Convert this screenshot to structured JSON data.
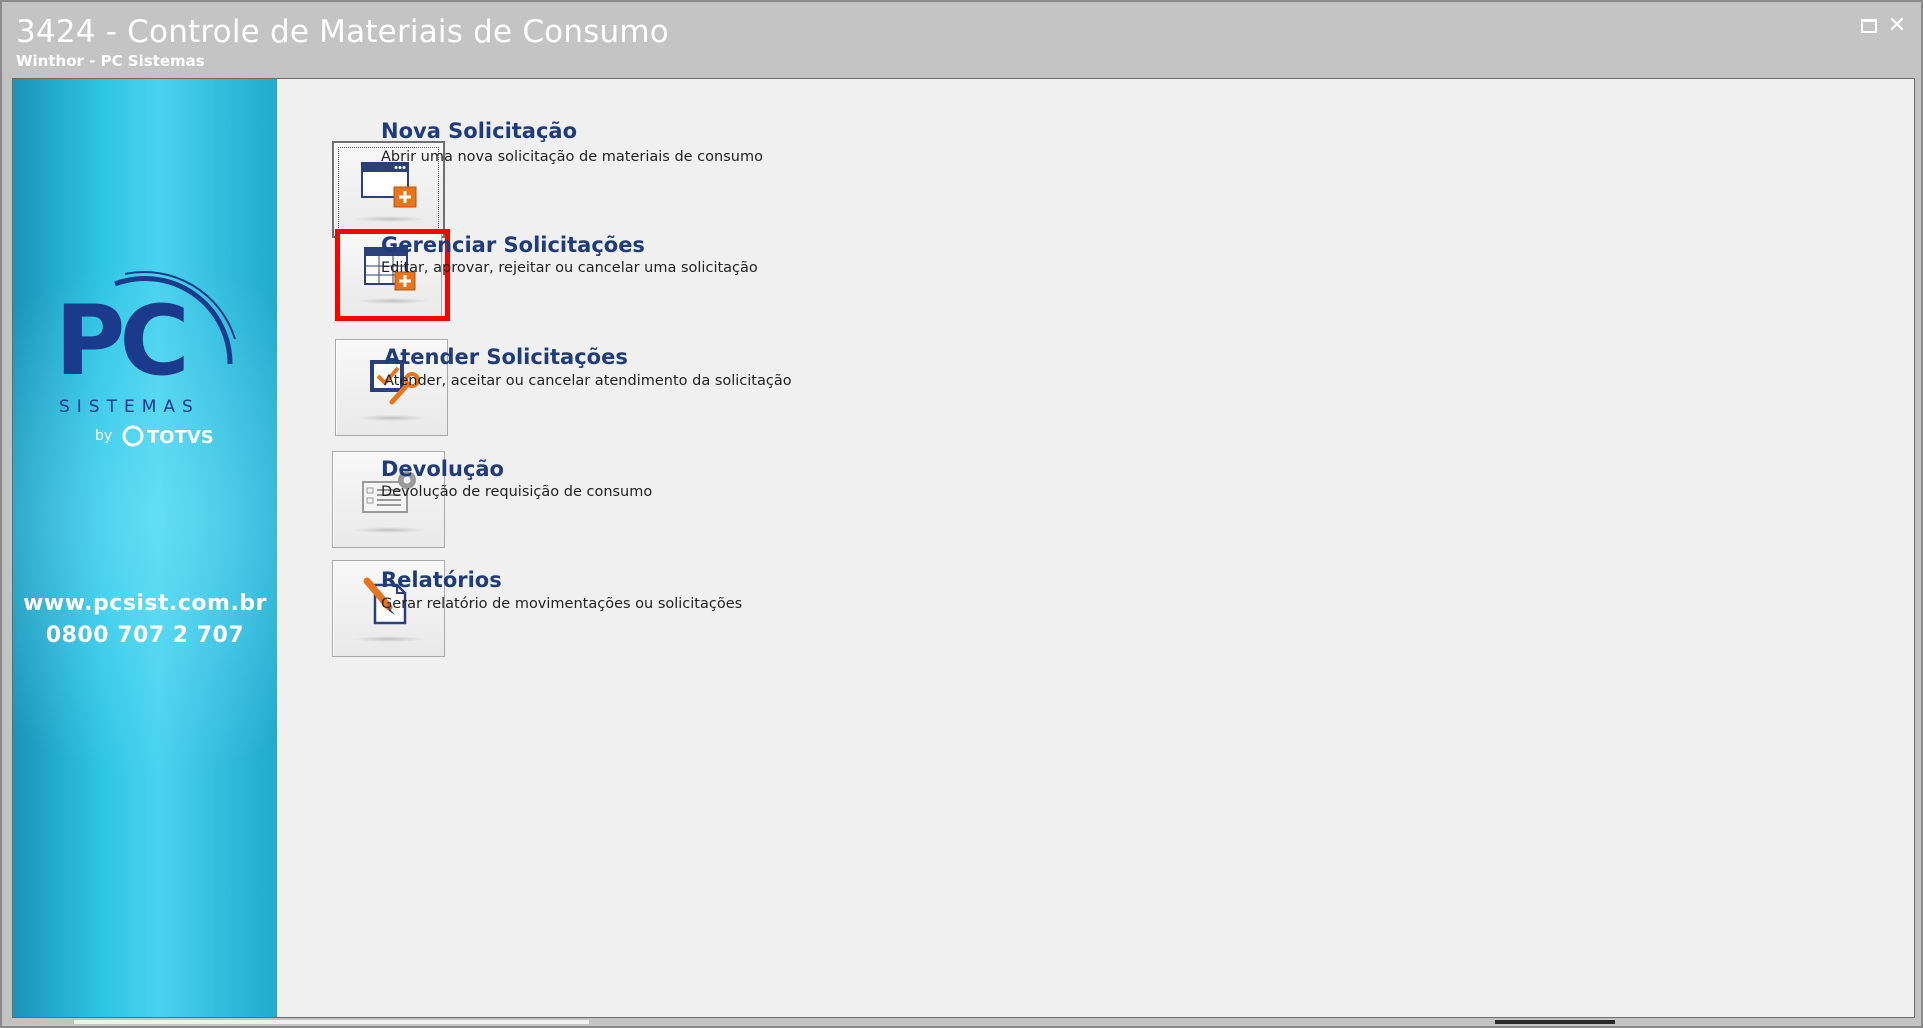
{
  "window": {
    "title": "3424 - Controle de Materiais de Consumo",
    "subtitle": "Winthor - PC Sistemas",
    "maximize_icon": "maximize-icon",
    "close_glyph": "✕"
  },
  "sidebar": {
    "logo_text": "PC",
    "logo_sub": "SISTEMAS",
    "logo_by": "by",
    "logo_totvs": "TOTVS",
    "url": "www.pcsist.com.br",
    "phone": "0800 707 2 707",
    "brand_colors": {
      "pc_blue": "#1b3a8c",
      "pc_orange": "#f5a623"
    }
  },
  "menu": {
    "items": [
      {
        "title": "Nova Solicitação",
        "description": "Abrir uma nova solicitação de materiais de consumo",
        "icon": "window-add-icon"
      },
      {
        "title": "Gerenciar Solicitações",
        "description": "Editar, aprovar, rejeitar ou cancelar uma solicitação",
        "icon": "grid-add-icon"
      },
      {
        "title": "Atender Solicitações",
        "description": "Atender, aceitar ou cancelar atendimento da solicitação",
        "icon": "check-wrench-icon"
      },
      {
        "title": "Devolução",
        "description": "Devolução de requisição de consumo",
        "icon": "form-gear-icon"
      },
      {
        "title": "Relatórios",
        "description": "Gerar relatório de movimentações ou solicitações",
        "icon": "report-pen-icon"
      }
    ]
  },
  "colors": {
    "title_blue": "#1f3b7a",
    "highlight": "#ff0000",
    "accent_orange": "#e8741c"
  }
}
